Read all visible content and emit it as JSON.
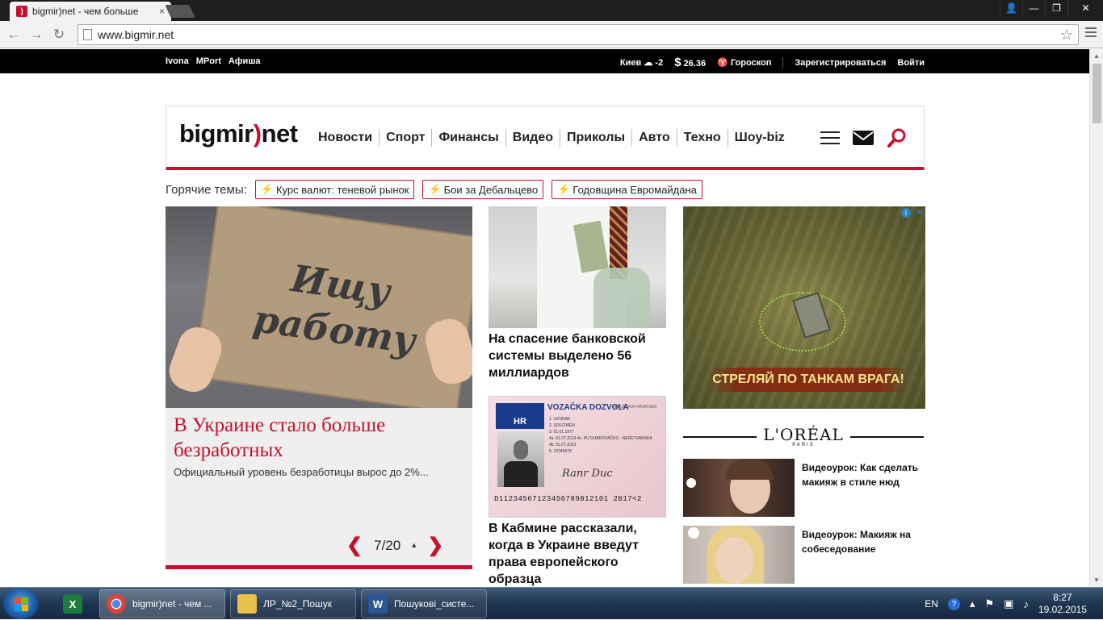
{
  "browser": {
    "tab_title": "bigmir)net - чем больше",
    "tab_favicon": ")",
    "close_glyph": "×",
    "url": "www.bigmir.net",
    "back_glyph": "←",
    "forward_glyph": "→",
    "reload_glyph": "↻",
    "star_glyph": "☆",
    "window_controls": {
      "user": "👤",
      "minimize": "—",
      "maximize": "❐",
      "close": "✕"
    }
  },
  "topstrip": {
    "links": [
      "Ivona",
      "MPort",
      "Афиша"
    ],
    "city": "Киев",
    "weather_icon": "☁",
    "temperature": "-2",
    "currency_symbol": "$",
    "rate": "26.36",
    "horoscope_icon": "♈",
    "horoscope": "Гороскоп",
    "register": "Зарегистрироваться",
    "login": "Войти"
  },
  "header": {
    "logo_part1": "bigmir",
    "logo_bracket": ")",
    "logo_part2": "net",
    "nav": [
      "Новости",
      "Спорт",
      "Финансы",
      "Видео",
      "Приколы",
      "Авто",
      "Техно",
      "Шоу-biz"
    ],
    "accent_color": "#c8102e"
  },
  "hot_topics": {
    "label": "Горячие темы:",
    "chip_icon": "⚡",
    "items": [
      "Курс валют: теневой рынок",
      "Бои за Дебальцево",
      "Годовщина Евромайдана"
    ]
  },
  "lead": {
    "sign_line1": "Ищу",
    "sign_line2": "работу",
    "title": "В Украине стало больше безработных",
    "description": "Официальный уровень безработицы вырос до 2%...",
    "pager": "7/20",
    "prev_glyph": "❮",
    "next_glyph": "❯",
    "cursor_glyph": "▴"
  },
  "middle": {
    "story1_title": "На спасение банковской системы выделено 56 миллиардов",
    "story2_title": "В Кабмине рассказали, когда в Украине введут права европейского образца",
    "license": {
      "country_code": "HR",
      "title": "VOZAČKA DOZVOLA",
      "republic": "REPUBLIKA HRVATSKA",
      "lines": [
        "1. UZORAK",
        "2. SPECIMEN",
        "3. 01.01.1977",
        "4a. 01.07.2013  4c. PU DUBROVAČKO - NERETVANSKA",
        "4b. 01.07.2023",
        "5. 12345678"
      ],
      "signature": "Ranr Duc",
      "mrz": "D11234567123456789012101 2017<2"
    }
  },
  "right": {
    "ad_text": "СТРЕЛЯЙ ПО ТАНКАМ ВРАГА!",
    "ad_info": "i",
    "ad_close": "✕",
    "brand": "L'ORÉAL",
    "brand_sub": "PARIS",
    "videos": [
      {
        "title": "Видеоурок: Как сделать макияж в стиле нюд"
      },
      {
        "title": "Видеоурок: Макияж на собеседование"
      }
    ]
  },
  "scrollbar": {
    "up": "▲",
    "down": "▼"
  },
  "taskbar": {
    "items": [
      {
        "label": "bigmir)net - чем ...",
        "icon": "chrome"
      },
      {
        "label": "ЛР_№2_Пошук",
        "icon": "folder"
      },
      {
        "label": "Пошукові_систе...",
        "icon": "word"
      }
    ],
    "excel_icon_letter": "X",
    "word_icon_letter": "W",
    "language": "EN",
    "help_icon": "?",
    "time": "8:27",
    "date": "19.02.2015"
  }
}
